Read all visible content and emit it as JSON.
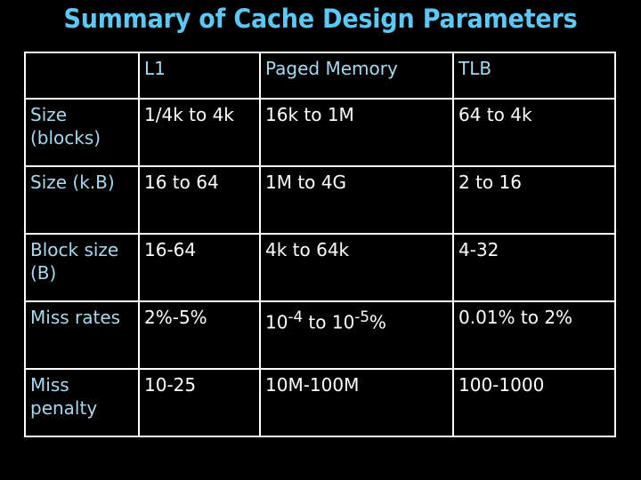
{
  "slide": {
    "title": "Summary of Cache Design Parameters",
    "title_color": "#5BC8F5",
    "background_color": "#000000",
    "border_color": "#FFFFFF",
    "label_color": "#A8D8EE",
    "value_color": "#FFFFFF"
  },
  "table": {
    "headers": [
      "",
      "L1",
      "Paged Memory",
      "TLB"
    ],
    "rows": [
      {
        "label": "Size (blocks)",
        "l1": "1/4k to 4k",
        "paged_memory": "16k to 1M",
        "tlb": "64 to 4k"
      },
      {
        "label": "Size (k.B)",
        "l1": "16 to 64",
        "paged_memory": "1M to 4G",
        "tlb": "2 to 16"
      },
      {
        "label": "Block size (B)",
        "l1": "16-64",
        "paged_memory": "4k to 64k",
        "tlb": "4-32"
      },
      {
        "label": "Miss rates",
        "l1": "2%-5%",
        "paged_memory_html": "10<sup>-4</sup> to 10<sup>-5</sup>%",
        "paged_memory": "10-4 to 10-5%",
        "tlb": "0.01% to 2%"
      },
      {
        "label": "Miss penalty",
        "l1": "10-25",
        "paged_memory": "10M-100M",
        "tlb": "100-1000"
      }
    ]
  }
}
